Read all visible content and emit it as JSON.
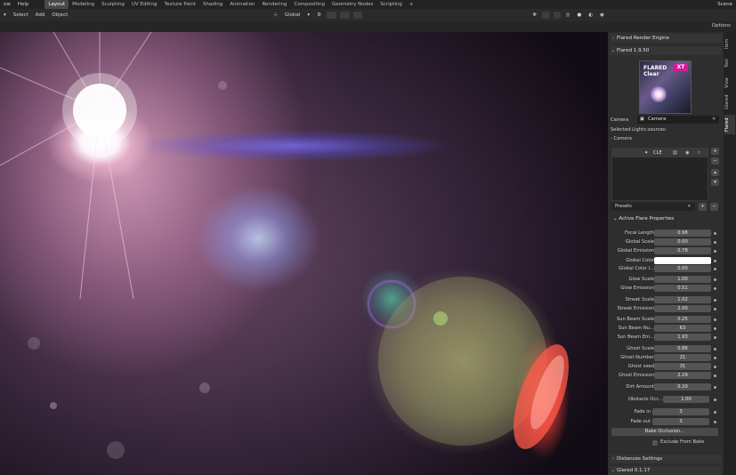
{
  "menu": {
    "items": [
      "ow",
      "Help"
    ],
    "workspaces": [
      "Layout",
      "Modeling",
      "Sculpting",
      "UV Editing",
      "Texture Paint",
      "Shading",
      "Animation",
      "Rendering",
      "Compositing",
      "Geometry Nodes",
      "Scripting"
    ],
    "active_workspace": "Layout",
    "add_tab": "+",
    "scene_label": "Scene"
  },
  "header": {
    "items": [
      "Select",
      "Add",
      "Object"
    ],
    "transform_orientation": "Global",
    "options_label": "Options"
  },
  "side_tabs": [
    "Item",
    "Tool",
    "View",
    "Glared",
    "Flared"
  ],
  "active_side_tab": "Flared",
  "panel": {
    "render_engine_header": "Flared Render Engine",
    "addon_header": "Flared 1.9.50",
    "logo": {
      "line1": "FLARED",
      "line2": "Clear",
      "badge": "XT"
    },
    "camera_label": "Camera",
    "camera_value": "Camera",
    "selected_lights_label": "Selected Lights sources:",
    "selected_light_item": "- Camera",
    "light_list_item": "CLE",
    "presets_label": "Presets",
    "active_flare_header": "Active Flare Properties",
    "properties": [
      {
        "label": "Focal Length",
        "value": "0.98"
      },
      {
        "label": "Global Scale",
        "value": "0.00"
      },
      {
        "label": "Global Emission",
        "value": "0.78"
      },
      {
        "label": "Global Color",
        "value": ""
      },
      {
        "label": "Global Color I...",
        "value": "0.00"
      },
      {
        "label": "Glow Scale",
        "value": "1.00"
      },
      {
        "label": "Glow Emission",
        "value": "0.51"
      },
      {
        "label": "Streak Scale",
        "value": "1.02"
      },
      {
        "label": "Streak Emission",
        "value": "2.00"
      },
      {
        "label": "Sun Beam Scale",
        "value": "0.25"
      },
      {
        "label": "Sun Beam Nu...",
        "value": "63"
      },
      {
        "label": "Sun Beam Em...",
        "value": "1.93"
      },
      {
        "label": "Ghost Scale",
        "value": "0.86"
      },
      {
        "label": "Ghost Number",
        "value": "21"
      },
      {
        "label": "Ghost seed",
        "value": "31"
      },
      {
        "label": "Ghost Emission",
        "value": "2.29"
      },
      {
        "label": "Dirt Amount",
        "value": "0.20"
      }
    ],
    "obstacle_label": "Obstacle Occ...",
    "obstacle_value": "1.00",
    "fade_in_label": "Fade in",
    "fade_in_value": "3",
    "fade_out_label": "Fade out",
    "fade_out_value": "3",
    "bake_button": "Bake Occlusion...",
    "exclude_label": "Exclude From Bake",
    "distances_header": "Distances Settings",
    "glared_header": "Glared 0.1.17"
  },
  "colors": {
    "global_color_swatch": "#ffffff",
    "logo_badge": "#d6199a"
  }
}
